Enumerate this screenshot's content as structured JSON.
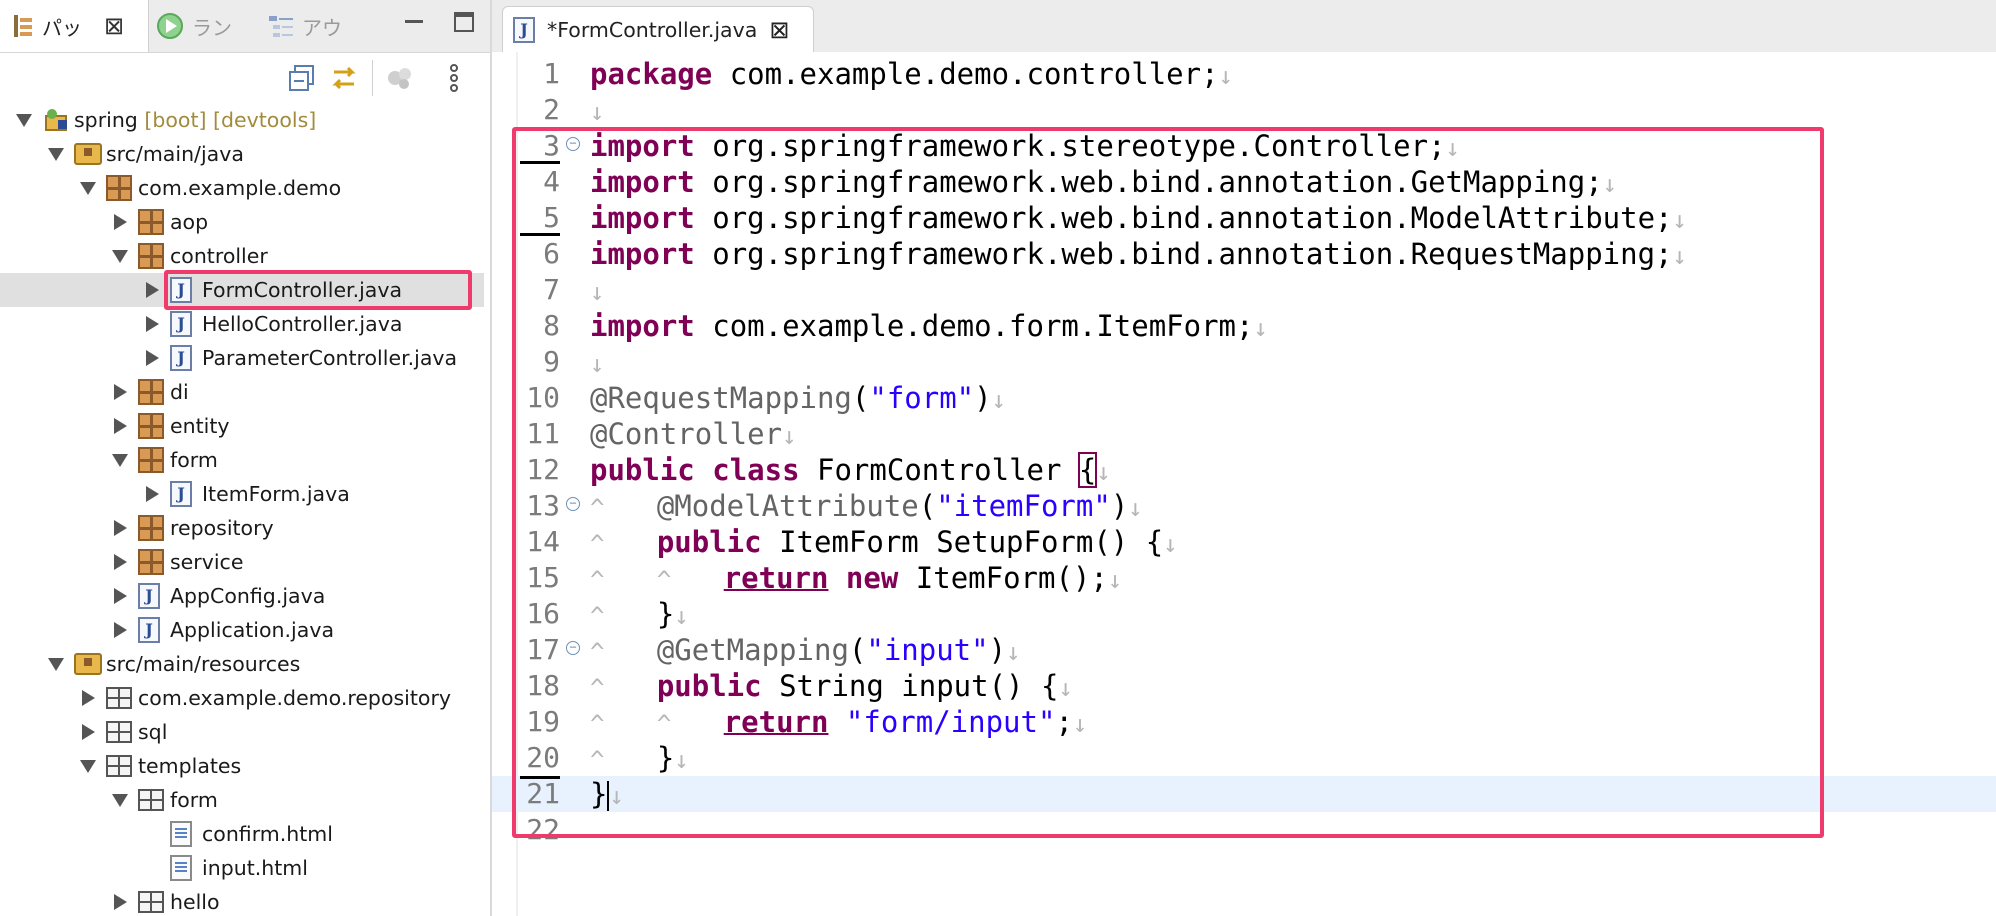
{
  "left_panel": {
    "tabs": [
      {
        "label": "パッ",
        "active": true
      },
      {
        "label": "ラン",
        "active": false
      },
      {
        "label": "アウ",
        "active": false
      }
    ],
    "close_glyph": "⊠",
    "tree": [
      {
        "label": "spring",
        "suffix": "[boot] [devtools]",
        "icon": "project-icon",
        "indent": 0,
        "state": "open"
      },
      {
        "label": "src/main/java",
        "icon": "source-folder-icon",
        "indent": 1,
        "state": "open"
      },
      {
        "label": "com.example.demo",
        "icon": "package-icon",
        "indent": 2,
        "state": "open"
      },
      {
        "label": "aop",
        "icon": "package-icon",
        "indent": 3,
        "state": "closed"
      },
      {
        "label": "controller",
        "icon": "package-icon",
        "indent": 3,
        "state": "open"
      },
      {
        "label": "FormController.java",
        "icon": "java-file-icon",
        "indent": 4,
        "state": "closed",
        "selected": true
      },
      {
        "label": "HelloController.java",
        "icon": "java-file-icon",
        "indent": 4,
        "state": "closed"
      },
      {
        "label": "ParameterController.java",
        "icon": "java-file-icon",
        "indent": 4,
        "state": "closed"
      },
      {
        "label": "di",
        "icon": "package-icon",
        "indent": 3,
        "state": "closed"
      },
      {
        "label": "entity",
        "icon": "package-icon",
        "indent": 3,
        "state": "closed"
      },
      {
        "label": "form",
        "icon": "package-icon",
        "indent": 3,
        "state": "open"
      },
      {
        "label": "ItemForm.java",
        "icon": "java-file-icon",
        "indent": 4,
        "state": "closed"
      },
      {
        "label": "repository",
        "icon": "package-icon",
        "indent": 3,
        "state": "closed"
      },
      {
        "label": "service",
        "icon": "package-icon",
        "indent": 3,
        "state": "closed"
      },
      {
        "label": "AppConfig.java",
        "icon": "java-file-icon",
        "indent": 3,
        "state": "closed"
      },
      {
        "label": "Application.java",
        "icon": "java-file-icon",
        "indent": 3,
        "state": "closed"
      },
      {
        "label": "src/main/resources",
        "icon": "source-folder-icon",
        "indent": 1,
        "state": "open"
      },
      {
        "label": "com.example.demo.repository",
        "icon": "resource-folder-icon",
        "indent": 2,
        "state": "closed"
      },
      {
        "label": "sql",
        "icon": "resource-folder-icon",
        "indent": 2,
        "state": "closed"
      },
      {
        "label": "templates",
        "icon": "resource-folder-icon",
        "indent": 2,
        "state": "open"
      },
      {
        "label": "form",
        "icon": "resource-folder-icon",
        "indent": 3,
        "state": "open"
      },
      {
        "label": "confirm.html",
        "icon": "html-file-icon",
        "indent": 4,
        "state": "none"
      },
      {
        "label": "input.html",
        "icon": "html-file-icon",
        "indent": 4,
        "state": "none"
      },
      {
        "label": "hello",
        "icon": "resource-folder-icon",
        "indent": 3,
        "state": "closed"
      }
    ],
    "highlight_color": "#ef3b6c"
  },
  "editor": {
    "tab_label": "*FormController.java",
    "lines": [
      {
        "n": "1",
        "segs": [
          [
            "kw",
            "package"
          ],
          [
            "",
            "com.example.demo.controller;"
          ]
        ]
      },
      {
        "n": "2",
        "segs": []
      },
      {
        "n": "3",
        "fold": true,
        "segs": [
          [
            "kw",
            "import"
          ],
          [
            "",
            "org.springframework.stereotype.Controller;"
          ]
        ]
      },
      {
        "n": "4",
        "segs": [
          [
            "kw",
            "import"
          ],
          [
            "",
            "org.springframework.web.bind.annotation.GetMapping;"
          ]
        ]
      },
      {
        "n": "5",
        "segs": [
          [
            "kw",
            "import"
          ],
          [
            "",
            "org.springframework.web.bind.annotation.ModelAttribute;"
          ]
        ]
      },
      {
        "n": "6",
        "segs": [
          [
            "kw",
            "import"
          ],
          [
            "",
            "org.springframework.web.bind.annotation.RequestMapping;"
          ]
        ]
      },
      {
        "n": "7",
        "segs": []
      },
      {
        "n": "8",
        "segs": [
          [
            "kw",
            "import"
          ],
          [
            "",
            "com.example.demo.form.ItemForm;"
          ]
        ]
      },
      {
        "n": "9",
        "segs": []
      },
      {
        "n": "10",
        "segs": [
          [
            "an",
            "@RequestMapping"
          ],
          [
            "",
            "("
          ],
          [
            "st",
            "\"form\""
          ],
          [
            "",
            ")"
          ]
        ]
      },
      {
        "n": "11",
        "segs": [
          [
            "an",
            "@Controller"
          ]
        ]
      },
      {
        "n": "12",
        "segs": [
          [
            "kw",
            "public"
          ],
          [
            "kw",
            "class"
          ],
          [
            "",
            "FormController"
          ],
          [
            "box",
            "{"
          ]
        ]
      },
      {
        "n": "13",
        "fold": true,
        "segs": [
          [
            "ws",
            "^"
          ],
          [
            "an",
            "@ModelAttribute"
          ],
          [
            "",
            "("
          ],
          [
            "st",
            "\"itemForm\""
          ],
          [
            "",
            ")"
          ]
        ]
      },
      {
        "n": "14",
        "segs": [
          [
            "ws",
            "^"
          ],
          [
            "kw",
            "public"
          ],
          [
            "",
            "ItemForm SetupForm() {"
          ]
        ]
      },
      {
        "n": "15",
        "segs": [
          [
            "ws",
            "^"
          ],
          [
            "ws",
            "^"
          ],
          [
            "kwu",
            "return"
          ],
          [
            "kw",
            "new"
          ],
          [
            "",
            "ItemForm();"
          ]
        ]
      },
      {
        "n": "16",
        "segs": [
          [
            "ws",
            "^"
          ],
          [
            "",
            "}"
          ]
        ]
      },
      {
        "n": "17",
        "fold": true,
        "segs": [
          [
            "ws",
            "^"
          ],
          [
            "an",
            "@GetMapping"
          ],
          [
            "",
            "("
          ],
          [
            "st",
            "\"input\""
          ],
          [
            "",
            ")"
          ]
        ]
      },
      {
        "n": "18",
        "segs": [
          [
            "ws",
            "^"
          ],
          [
            "kw",
            "public"
          ],
          [
            "",
            "String input() {"
          ]
        ]
      },
      {
        "n": "19",
        "segs": [
          [
            "ws",
            "^"
          ],
          [
            "ws",
            "^"
          ],
          [
            "kwu",
            "return"
          ],
          [
            "st",
            "\"form/input\""
          ],
          [
            "",
            ";"
          ]
        ]
      },
      {
        "n": "20",
        "segs": [
          [
            "ws",
            "^"
          ],
          [
            "",
            "}"
          ]
        ]
      },
      {
        "n": "21",
        "current": true,
        "segs": [
          [
            "",
            "}"
          ]
        ]
      },
      {
        "n": "22",
        "segs": []
      }
    ],
    "newline_glyph": "↓"
  }
}
